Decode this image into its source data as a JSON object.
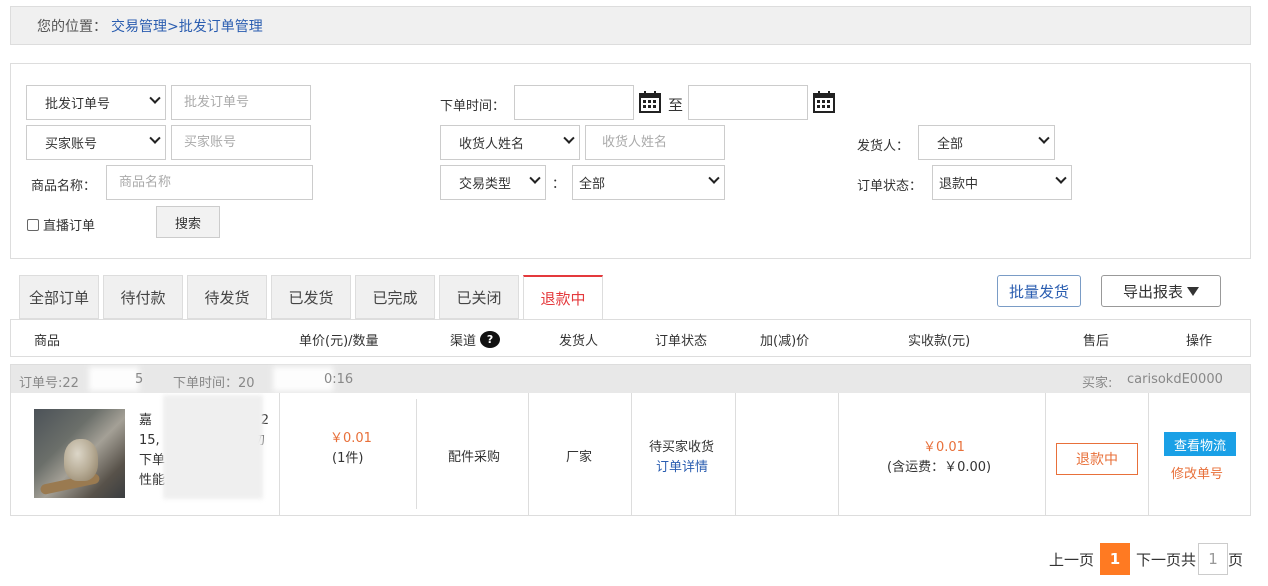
{
  "breadcrumb": {
    "label": "您的位置：",
    "parent": "交易管理>",
    "current": "批发订单管理"
  },
  "filters": {
    "order_no_select": "批发订单号",
    "order_no_placeholder": "批发订单号",
    "buyer_select": "买家账号",
    "buyer_placeholder": "买家账号",
    "product_label": "商品名称：",
    "product_placeholder": "商品名称",
    "order_time_label": "下单时间：",
    "to_label": "至",
    "receiver_select": "收货人姓名",
    "receiver_placeholder": "收货人姓名",
    "trade_type_select": "交易类型",
    "colon": "：",
    "trade_type_value": "全部",
    "shipper_label": "发货人：",
    "shipper_value": "全部",
    "status_label": "订单状态：",
    "status_value": "退款中",
    "live_checkbox_label": "直播订单",
    "search_button": "搜索"
  },
  "tabs": [
    "全部订单",
    "待付款",
    "待发货",
    "已发货",
    "已完成",
    "已关闭",
    "退款中"
  ],
  "actions": {
    "batch_ship": "批量发货",
    "export": "导出报表"
  },
  "table": {
    "headers": {
      "product": "商品",
      "price_qty": "单价(元)/数量",
      "channel": "渠道",
      "channel_help": "?",
      "shipper": "发货人",
      "status": "订单状态",
      "adjust": "加(减)价",
      "received": "实收款(元)",
      "after_sale": "售后",
      "operation": "操作"
    }
  },
  "order": {
    "order_no_prefix": "订单号:22",
    "order_no_suffix": "5",
    "order_time_prefix": "下单时间：20",
    "order_time_suffix": "0:16",
    "buyer_label": "买家:",
    "buyer_name": "carisokdE0000",
    "product_line1": "嘉",
    "product_line1_end": "2",
    "product_line2": "15,",
    "product_line2_end": "勿",
    "product_line3": "下单",
    "product_line4": "性能",
    "unit_price": "￥0.01",
    "quantity": "(1件)",
    "channel": "配件采购",
    "shipper": "厂家",
    "status": "待买家收货",
    "detail_link": "订单详情",
    "received": "￥0.01",
    "shipping_note": "(含运费：￥0.00)",
    "refund_button": "退款中",
    "logistics_button": "查看物流",
    "modify_link": "修改单号"
  },
  "pager": {
    "prev": "上一页",
    "current": "1",
    "next": "下一页",
    "total_prefix": "共",
    "total": "1",
    "total_suffix": "页"
  }
}
